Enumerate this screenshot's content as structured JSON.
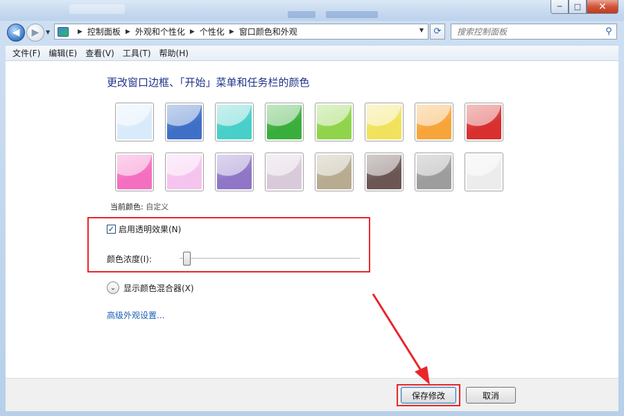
{
  "window": {
    "controls": {
      "minimize": "─",
      "maximize": "□",
      "close": "✕"
    }
  },
  "nav": {
    "back_icon": "back-arrow-icon",
    "forward_icon": "forward-arrow-icon",
    "breadcrumbs": [
      "控制面板",
      "外观和个性化",
      "个性化",
      "窗口颜色和外观"
    ],
    "refresh_icon": "refresh-icon",
    "search": {
      "placeholder": "搜索控制面板",
      "icon": "search-icon"
    }
  },
  "menu": {
    "items": [
      "文件(F)",
      "编辑(E)",
      "查看(V)",
      "工具(T)",
      "帮助(H)"
    ]
  },
  "main": {
    "heading": "更改窗口边框、「开始」菜单和任务栏的颜色",
    "swatch_rows": [
      [
        "#d9ebfb",
        "#3f6fc7",
        "#48cfc9",
        "#3aae3c",
        "#8fd44a",
        "#f0e25c",
        "#f7a53a",
        "#d7302f"
      ],
      [
        "#f56fc1",
        "#f5c4ee",
        "#8f76c6",
        "#d8cad9",
        "#b7ab90",
        "#6b5654",
        "#9d9d9d",
        "#ececec"
      ]
    ],
    "current_color_label": "当前颜色:",
    "current_color_value": "自定义",
    "transparency_label": "启用透明效果(N)",
    "transparency_checked": true,
    "intensity_label": "颜色浓度(I):",
    "intensity_value": 0.02,
    "mixer_label": "显示颜色混合器(X)",
    "advanced_link": "高级外观设置..."
  },
  "footer": {
    "save_label": "保存修改",
    "cancel_label": "取消"
  },
  "annotation_color": "#e8262c"
}
